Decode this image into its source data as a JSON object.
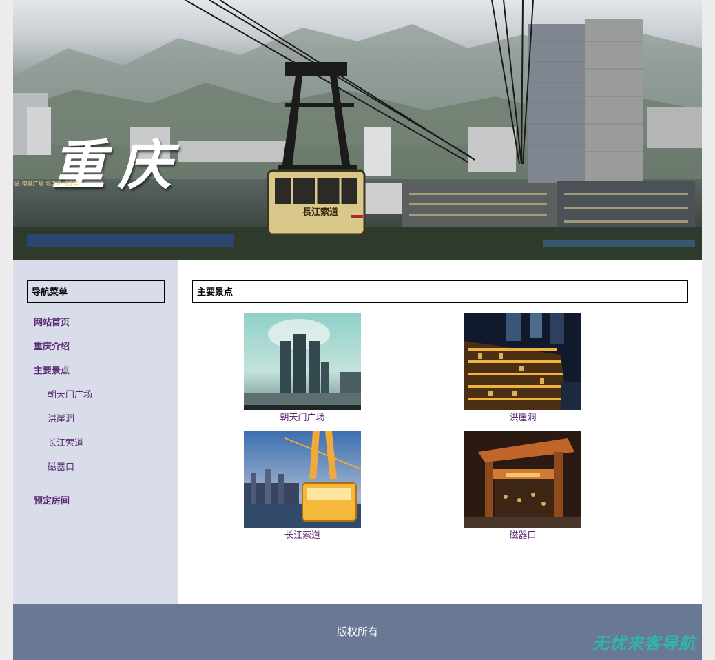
{
  "banner": {
    "title": "重庆",
    "cablecar_label": "長江索道",
    "sign_text": "區 環城广場 北部時尚佳樂"
  },
  "sidebar": {
    "header": "导航菜单",
    "items": [
      {
        "label": "网站首页"
      },
      {
        "label": "重庆介绍"
      },
      {
        "label": "主要景点"
      }
    ],
    "sub_items": [
      {
        "label": "朝天门广场"
      },
      {
        "label": "洪崖洞"
      },
      {
        "label": "长江索道"
      },
      {
        "label": "磁器口"
      }
    ],
    "bottom_item": {
      "label": "预定房间"
    }
  },
  "main": {
    "header": "主要景点",
    "attractions": [
      {
        "caption": "朝天门广场",
        "image": "chaotianmen-photo"
      },
      {
        "caption": "洪崖洞",
        "image": "hongyadong-night-photo"
      },
      {
        "caption": "长江索道",
        "image": "yangtze-cablecar-photo"
      },
      {
        "caption": "磁器口",
        "image": "ciqikou-gate-night-photo"
      }
    ]
  },
  "footer": {
    "text": "版权所有"
  },
  "watermark": {
    "text": "无忧来客导航"
  },
  "colors": {
    "page_bg": "#ececec",
    "sidebar_bg": "#d8dde9",
    "link": "#5b2a73",
    "footer_bg": "#687895",
    "watermark": "#2fb7a5"
  }
}
